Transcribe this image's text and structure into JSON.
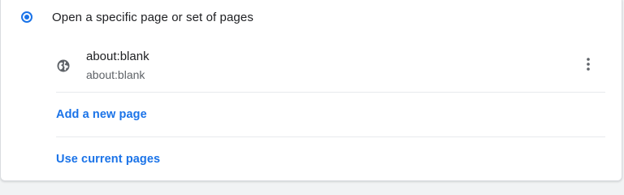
{
  "startup": {
    "option_label": "Open a specific page or set of pages",
    "option_selected": true
  },
  "pages": [
    {
      "title": "about:blank",
      "url": "about:blank",
      "icon": "globe-icon",
      "menu_icon": "more-vert-icon"
    }
  ],
  "actions": {
    "add_page_label": "Add a new page",
    "use_current_label": "Use current pages"
  },
  "colors": {
    "accent": "#1a73e8",
    "text_primary": "#202124",
    "text_secondary": "#5f6368",
    "divider": "#e8eaed"
  }
}
